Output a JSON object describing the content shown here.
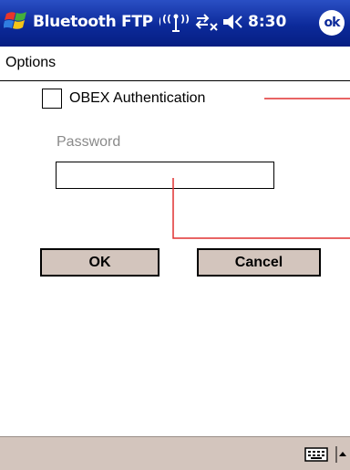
{
  "titlebar": {
    "title": "Bluetooth FTP (!",
    "time": "8:30",
    "ok_label": "ok"
  },
  "menu": {
    "options_label": "Options"
  },
  "form": {
    "obex_auth_label": "OBEX Authentication",
    "obex_auth_checked": false,
    "password_label": "Password",
    "password_value": ""
  },
  "buttons": {
    "ok_label": "OK",
    "cancel_label": "Cancel"
  },
  "colors": {
    "titlebar": "#0c2a9a",
    "button_face": "#d3c5bd",
    "callout": "#e03030"
  }
}
